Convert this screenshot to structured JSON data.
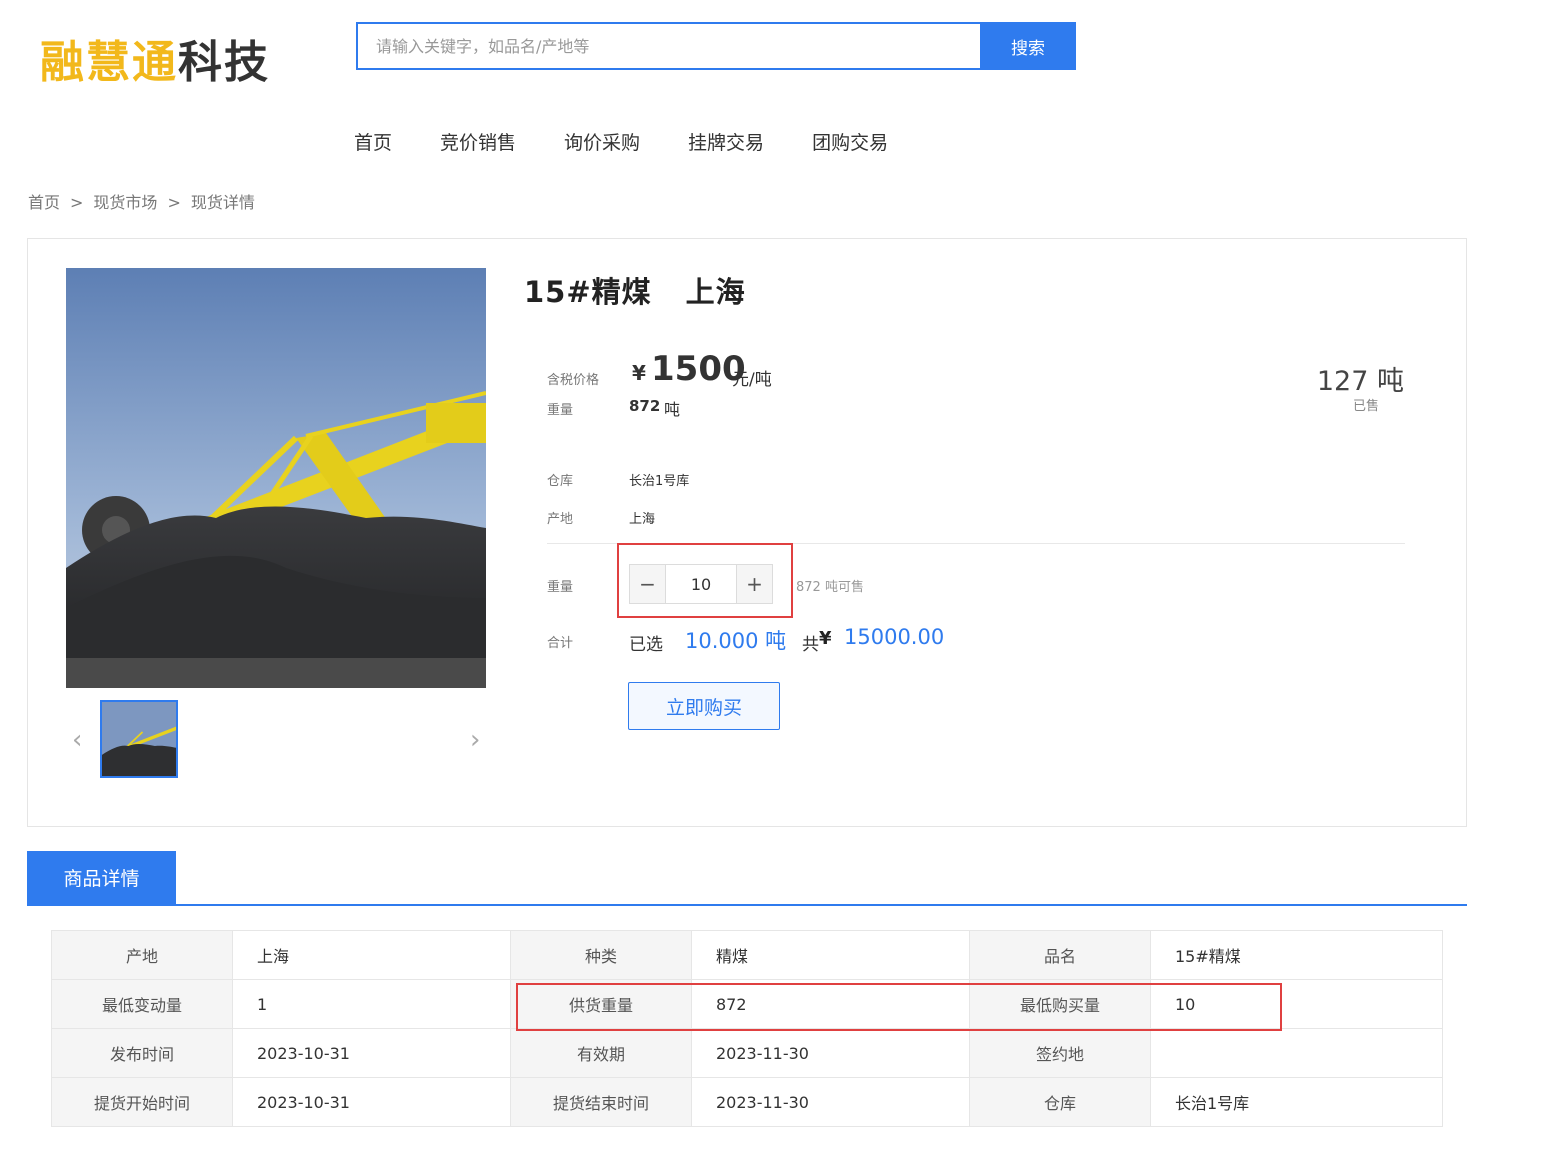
{
  "header": {
    "logo_gold": "融慧通",
    "logo_dark": "科技",
    "search_placeholder": "请输入关键字，如品名/产地等",
    "search_button": "搜索"
  },
  "nav": [
    "首页",
    "竞价销售",
    "询价采购",
    "挂牌交易",
    "团购交易"
  ],
  "breadcrumb": [
    "首页",
    "现货市场",
    "现货详情"
  ],
  "breadcrumb_separator": ">",
  "product": {
    "name": "15#精煤",
    "location": "上海",
    "price_label": "含税价格",
    "price_currency": "¥",
    "price_value": "1500",
    "price_unit": "元/吨",
    "weight_label": "重量",
    "weight_value": "872",
    "weight_unit": "吨",
    "sold_value": "127 吨",
    "sold_label": "已售",
    "warehouse_label": "仓库",
    "warehouse_value": "长治1号库",
    "origin_label": "产地",
    "origin_value": "上海",
    "qty_label": "重量",
    "qty_value": "10",
    "qty_minus": "−",
    "qty_plus": "+",
    "available_text": "872 吨可售",
    "total_label": "合计",
    "selected_label": "已选",
    "selected_value": "10.000 吨",
    "total_prefix": "共",
    "total_currency": "¥",
    "total_value": "15000.00",
    "buy_button": "立即购买",
    "prev_arrow": "‹",
    "next_arrow": "›"
  },
  "tabs": {
    "active": "商品详情"
  },
  "details": [
    [
      {
        "k": "产地",
        "v": "上海"
      },
      {
        "k": "种类",
        "v": "精煤"
      },
      {
        "k": "品名",
        "v": "15#精煤"
      }
    ],
    [
      {
        "k": "最低变动量",
        "v": "1"
      },
      {
        "k": "供货重量",
        "v": "872"
      },
      {
        "k": "最低购买量",
        "v": "10"
      }
    ],
    [
      {
        "k": "发布时间",
        "v": "2023-10-31"
      },
      {
        "k": "有效期",
        "v": "2023-11-30"
      },
      {
        "k": "签约地",
        "v": ""
      }
    ],
    [
      {
        "k": "提货开始时间",
        "v": "2023-10-31"
      },
      {
        "k": "提货结束时间",
        "v": "2023-11-30"
      },
      {
        "k": "仓库",
        "v": "长治1号库"
      }
    ]
  ],
  "colors": {
    "accent": "#2f7bee",
    "logo_gold": "#f2b81b",
    "highlight": "#e04040"
  }
}
